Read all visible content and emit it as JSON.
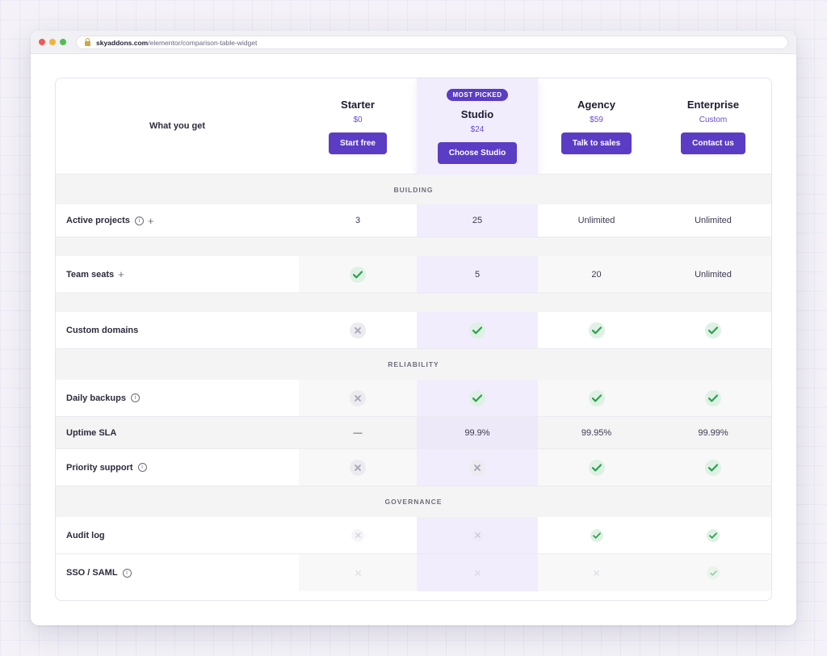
{
  "browser": {
    "url_domain": "skyaddons.com",
    "url_path": "/elementor/comparison-table-widget"
  },
  "table": {
    "header_label": "What you get",
    "badge": "MOST PICKED",
    "plans": [
      {
        "name": "Starter",
        "price": "$0",
        "button": "Start free"
      },
      {
        "name": "Studio",
        "price": "$24",
        "button": "Choose Studio"
      },
      {
        "name": "Agency",
        "price": "$59",
        "button": "Talk to sales"
      },
      {
        "name": "Enterprise",
        "price": "Custom",
        "button": "Contact us"
      }
    ],
    "sections": [
      "BUILDING",
      "RELIABILITY",
      "GOVERNANCE"
    ],
    "rows": [
      {
        "feature": "Active projects",
        "info": true,
        "plus": true,
        "values": [
          "3",
          "25",
          "Unlimited",
          "Unlimited"
        ]
      },
      {
        "feature": "Team seats",
        "info": false,
        "plus": true,
        "values": [
          "check",
          "5",
          "20",
          "Unlimited"
        ]
      },
      {
        "feature": "Custom domains",
        "info": false,
        "plus": false,
        "values": [
          "cross",
          "check",
          "check",
          "check"
        ]
      },
      {
        "feature": "Daily backups",
        "info": true,
        "plus": false,
        "values": [
          "cross",
          "check",
          "check",
          "check"
        ]
      },
      {
        "feature": "Uptime SLA",
        "info": false,
        "plus": false,
        "values": [
          "—",
          "99.9%",
          "99.95%",
          "99.99%"
        ]
      },
      {
        "feature": "Priority support",
        "info": true,
        "plus": false,
        "values": [
          "cross",
          "cross",
          "check",
          "check"
        ]
      },
      {
        "feature": "Audit log",
        "info": false,
        "plus": false,
        "values": [
          "cross",
          "cross",
          "check",
          "check"
        ]
      },
      {
        "feature": "SSO / SAML",
        "info": true,
        "plus": false,
        "values": [
          "cross",
          "cross",
          "cross",
          "check"
        ]
      }
    ]
  },
  "colors": {
    "accent": "#5b3cc4",
    "check": "#2fa04f",
    "highlight": "#f1edfd"
  },
  "icons": {
    "check": "check-icon",
    "cross": "cross-icon",
    "info": "info-icon",
    "plus": "plus-icon",
    "lock": "lock-icon"
  }
}
